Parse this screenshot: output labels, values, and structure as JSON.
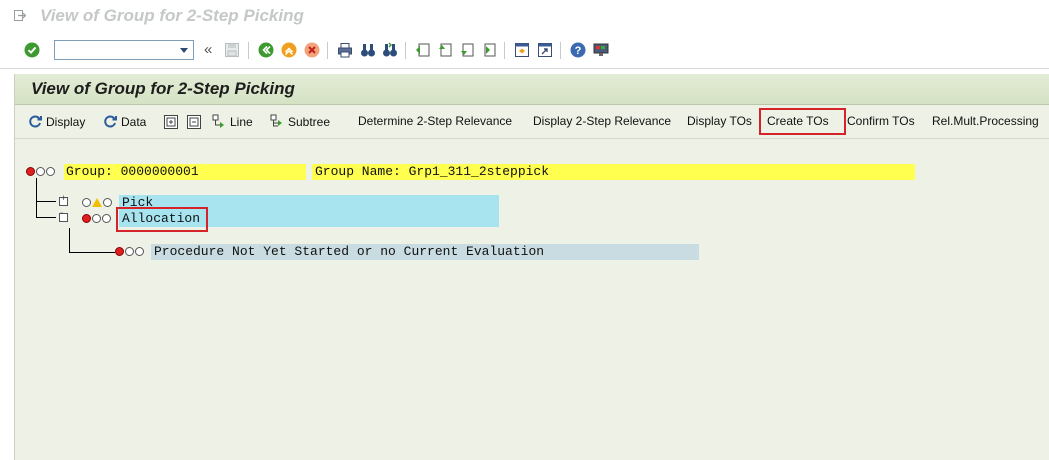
{
  "window": {
    "title": "View of Group for 2-Step Picking"
  },
  "std_toolbar": {
    "command_field": {
      "value": "",
      "placeholder": ""
    }
  },
  "screen": {
    "title": "View of Group for 2-Step Picking"
  },
  "app_toolbar": {
    "display": "Display",
    "data": "Data",
    "line": "Line",
    "subtree": "Subtree",
    "determine": "Determine 2-Step Relevance",
    "display_relevance": "Display 2-Step Relevance",
    "display_tos": "Display TOs",
    "create_tos": "Create TOs",
    "confirm_tos": "Confirm TOs",
    "rel_mult": "Rel.Mult.Processing"
  },
  "tree": {
    "group_label": "Group: 0000000001",
    "group_name": "Group Name: Grp1_311_2steppick",
    "node_pick": "Pick",
    "node_allocation": "Allocation",
    "status_text": "Procedure Not Yet Started or no Current Evaluation"
  },
  "colors": {
    "highlight_red": "#d4242a",
    "field_yellow": "#ffff4f",
    "field_blue": "#a8e4f0",
    "background": "#eef2e6"
  }
}
